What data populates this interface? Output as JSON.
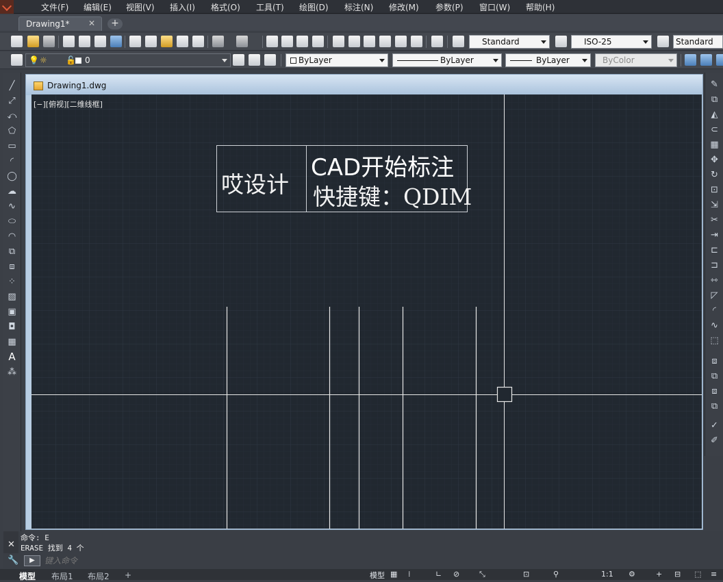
{
  "menu": [
    "文件(F)",
    "编辑(E)",
    "视图(V)",
    "插入(I)",
    "格式(O)",
    "工具(T)",
    "绘图(D)",
    "标注(N)",
    "修改(M)",
    "参数(P)",
    "窗口(W)",
    "帮助(H)"
  ],
  "tabs": {
    "active": "Drawing1*",
    "close": "✕",
    "add": "+"
  },
  "toolbar1": {
    "text_style": "Standard",
    "dim_style": "ISO-25",
    "table_style": "Standard"
  },
  "toolbar2": {
    "layer": "0",
    "color": "ByLayer",
    "linetype": "ByLayer",
    "lineweight": "ByLayer",
    "plotstyle": "ByColor"
  },
  "document": {
    "title": "Drawing1.dwg",
    "view_label": "[−][俯视][二维线框]"
  },
  "annotation": {
    "left": "哎设计",
    "right_line1": "CAD开始标注",
    "right_line2": "快捷键：QDIM"
  },
  "command": {
    "history": [
      "命令: E",
      "ERASE 找到 4 个"
    ],
    "placeholder": "键入命令",
    "prompt_icon": "▶"
  },
  "layout_tabs": [
    "模型",
    "布局1",
    "布局2",
    "+"
  ],
  "status": {
    "model_label": "模型",
    "scale": "1:1"
  },
  "colors": {
    "canvas": "#212830",
    "grid_minor": "#262e38",
    "grid_major": "#2e3742",
    "lines": "#e8e8e8"
  }
}
